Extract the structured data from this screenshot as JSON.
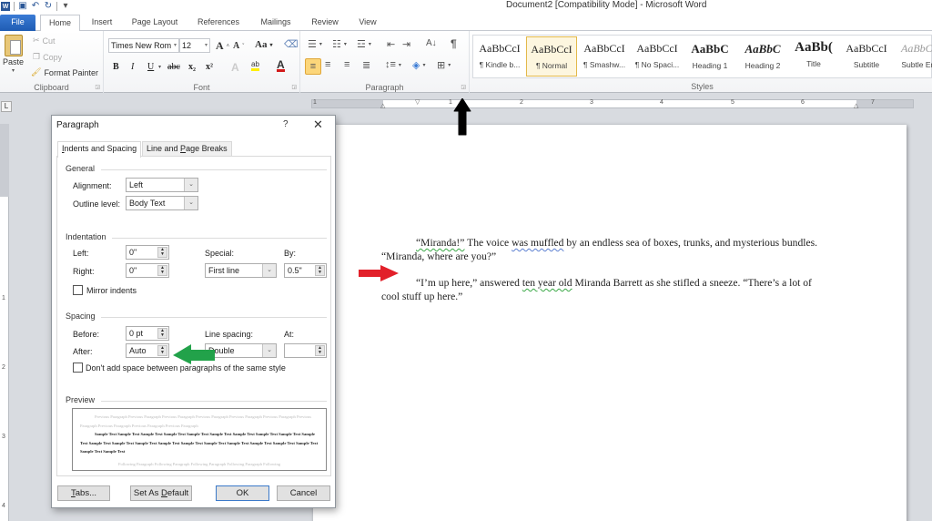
{
  "window": {
    "title": "Document2 [Compatibility Mode]  -  Microsoft Word",
    "qat": [
      {
        "name": "word-logo-icon",
        "glyph": "W"
      },
      {
        "name": "save-icon",
        "glyph": "▣"
      },
      {
        "name": "undo-icon",
        "glyph": "↶"
      },
      {
        "name": "redo-icon",
        "glyph": "↻"
      },
      {
        "name": "customize-qat-icon",
        "glyph": "▾"
      }
    ]
  },
  "tabs": {
    "file": "File",
    "home": "Home",
    "insert": "Insert",
    "page_layout": "Page Layout",
    "references": "References",
    "mailings": "Mailings",
    "review": "Review",
    "view": "View"
  },
  "ribbon": {
    "clipboard": {
      "label": "Clipboard",
      "paste": "Paste",
      "cut": "Cut",
      "copy": "Copy",
      "format_painter": "Format Painter"
    },
    "font": {
      "label": "Font",
      "font_name": "Times New Rom",
      "font_size": "12",
      "grow": "A",
      "shrink": "A",
      "change_case": "Aa",
      "bold": "B",
      "italic": "I",
      "underline": "U",
      "strike": "abc",
      "subscript": "x₂",
      "superscript": "x²",
      "text_effects": "A",
      "font_color": "A"
    },
    "paragraph": {
      "label": "Paragraph",
      "pilcrow": "¶",
      "sort": "A↓"
    },
    "styles": {
      "label": "Styles",
      "items": [
        {
          "sample": "AaBbCcI",
          "name": "¶ Kindle b..."
        },
        {
          "sample": "AaBbCcI",
          "name": "¶ Normal",
          "selected": true
        },
        {
          "sample": "AaBbCcI",
          "name": "¶ Smashw..."
        },
        {
          "sample": "AaBbCcI",
          "name": "¶ No Spaci..."
        },
        {
          "sample": "AaBbC",
          "name": "Heading 1"
        },
        {
          "sample": "AaBbC",
          "name": "Heading 2"
        },
        {
          "sample": "AaBb(",
          "name": "Title"
        },
        {
          "sample": "AaBbCcI",
          "name": "Subtitle"
        },
        {
          "sample": "AaBbCc",
          "name": "Subtle Em"
        }
      ]
    }
  },
  "ruler": {
    "h_numbers": [
      "1",
      "1",
      "2",
      "3",
      "4",
      "5",
      "6",
      "7"
    ],
    "v_numbers": [
      "1",
      "2",
      "3",
      "4"
    ],
    "tab_selector": "L"
  },
  "document": {
    "paragraphs": [
      {
        "parts": [
          {
            "text": "“Miranda!”",
            "squiggle": true
          },
          {
            "text": " The voice "
          },
          {
            "text": "was muffled",
            "squiggle": true
          },
          {
            "text": " by an endless sea of boxes, trunks, and mysterious bundles. “Miranda, where are you?”"
          }
        ]
      },
      {
        "parts": [
          {
            "text": "“I’m up here,” answered "
          },
          {
            "text": "ten year old",
            "squiggle": true
          },
          {
            "text": " Miranda Barrett as she stifled a sneeze. “There’s a lot of cool stuff up here.”"
          }
        ]
      }
    ]
  },
  "dialog": {
    "title": "Paragraph",
    "help": "?",
    "close": "✕",
    "tabs": {
      "indents_spacing": "Indents and Spacing",
      "line_page_breaks": "Line and Page Breaks"
    },
    "general": {
      "section": "General",
      "alignment_label": "Alignment:",
      "alignment_value": "Left",
      "outline_label": "Outline level:",
      "outline_value": "Body Text"
    },
    "indentation": {
      "section": "Indentation",
      "left_label": "Left:",
      "left_value": "0\"",
      "right_label": "Right:",
      "right_value": "0\"",
      "special_label": "Special:",
      "special_value": "First line",
      "by_label": "By:",
      "by_value": "0.5\"",
      "mirror_label": "Mirror indents",
      "mirror_checked": false
    },
    "spacing": {
      "section": "Spacing",
      "before_label": "Before:",
      "before_value": "0 pt",
      "after_label": "After:",
      "after_value": "Auto",
      "line_spacing_label": "Line spacing:",
      "line_spacing_value": "Double",
      "at_label": "At:",
      "at_value": "",
      "dont_add_label": "Don't add space between paragraphs of the same style",
      "dont_add_checked": false
    },
    "preview": {
      "section": "Preview",
      "previous": "Previous Paragraph Previous Paragraph Previous Paragraph Previous Paragraph Previous Paragraph Previous Paragraph Previous Paragraph Previous Paragraph Previous Paragraph Previous Paragraph",
      "sample": "Sample Text Sample Text Sample Text Sample Text Sample Text Sample Text Sample Text Sample Text Sample Text Sample Text Sample Text Sample Text Sample Text Sample Text Sample Text Sample Text Sample Text Sample Text Sample Text Sample Text Sample Text Sample Text",
      "following": "Following Paragraph Following Paragraph Following Paragraph Following Paragraph Following"
    },
    "buttons": {
      "tabs": "Tabs...",
      "set_default": "Set As Default",
      "ok": "OK",
      "cancel": "Cancel"
    }
  },
  "annotations": {
    "black_arrow_color": "#000000",
    "red_arrow_color": "#e2202a",
    "green_arrow_color": "#22a24a"
  }
}
